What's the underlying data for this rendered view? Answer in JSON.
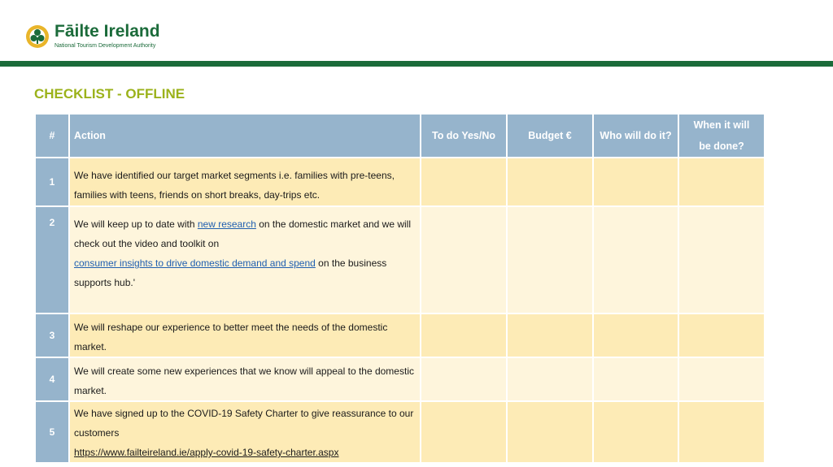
{
  "brand": {
    "name": "Fāilte Ireland",
    "tagline": "National Tourism Development Authority",
    "colors": {
      "green": "#1b6b3a",
      "gold": "#e9b52a",
      "title": "#9bb21a",
      "header_blue": "#96b4cc",
      "row_dark": "#fdebb6",
      "row_light": "#fef5dc"
    }
  },
  "page_title": "CHECKLIST - OFFLINE",
  "table": {
    "headers": {
      "num": "#",
      "action": "Action",
      "todo": "To do  Yes/No",
      "budget": "Budget €",
      "who": "Who will do it?",
      "when": "When it will be done?"
    },
    "rows": [
      {
        "num": "1",
        "text": "We have identified our target market segments i.e. families with pre-teens, families with teens, friends on short breaks, day-trips etc."
      },
      {
        "num": "2",
        "text_a": "We will keep up to date with ",
        "link1": "new research",
        "text_b": " on the domestic market and we will check out the video and toolkit on ",
        "link2": "consumer insights to drive domestic demand and spend",
        "text_c": " on the business supports hub.'"
      },
      {
        "num": "3",
        "text": "We will reshape our experience to better meet the needs of the domestic market."
      },
      {
        "num": "4",
        "text": "We will create some new experiences that we know will appeal to the domestic market."
      },
      {
        "num": "5",
        "text": "We have signed up to the COVID-19 Safety Charter to give reassurance to our customers",
        "link": "https://www.failteireland.ie/apply-covid-19-safety-charter.aspx"
      }
    ]
  }
}
